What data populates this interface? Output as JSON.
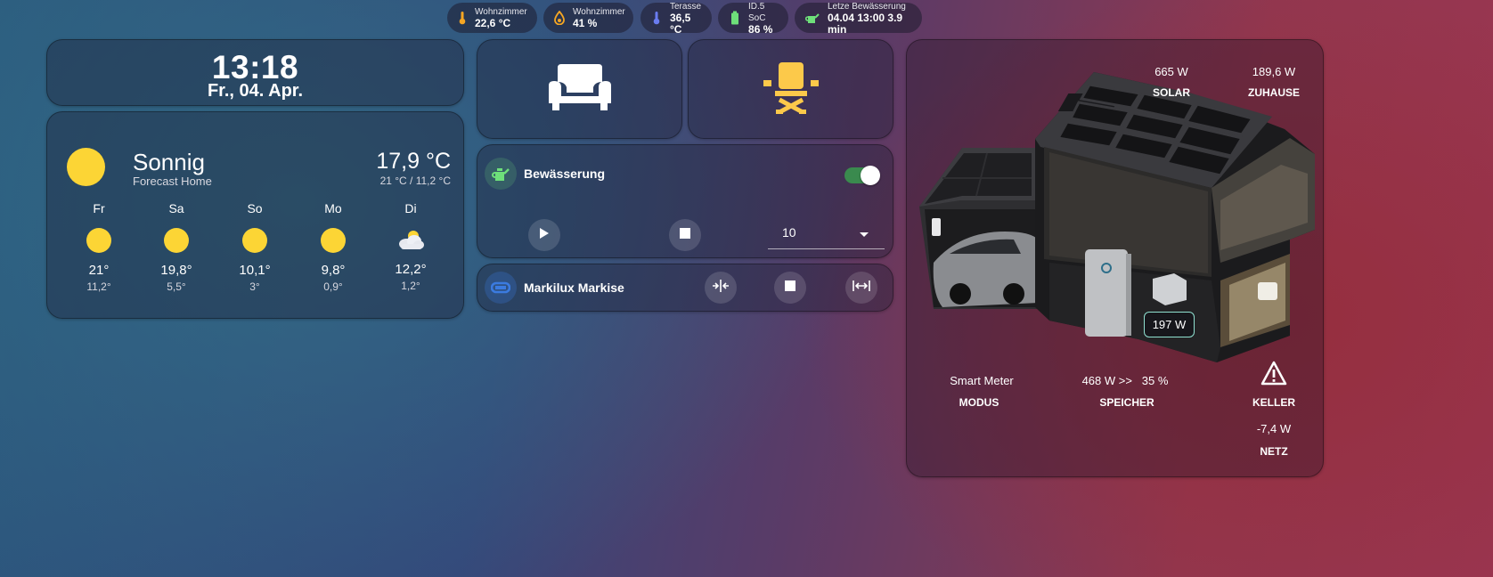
{
  "chips": [
    {
      "label": "Wohnzimmer",
      "value": "22,6 °C",
      "icon": "thermometer-icon",
      "color": "#f5a623"
    },
    {
      "label": "Wohnzimmer",
      "value": "41 %",
      "icon": "water-percent-icon",
      "color": "#f5a623"
    },
    {
      "label": "Terasse",
      "value": "36,5 °C",
      "icon": "thermometer-icon",
      "color": "#6a7cf0"
    },
    {
      "label": "ID.5 SoC",
      "value": "86 %",
      "icon": "battery-icon",
      "color": "#6ee07a"
    },
    {
      "label": "Letze Bewässerung",
      "value": "04.04 13:00 3.9 min",
      "icon": "watering-can-icon",
      "color": "#6ee07a"
    }
  ],
  "clock": {
    "time": "13:18",
    "date": "Fr., 04. Apr."
  },
  "weather": {
    "condition": "Sonnig",
    "subtitle": "Forecast Home",
    "temperature": "17,9 °C",
    "range": "21 °C / 11,2 °C",
    "forecast": [
      {
        "day": "Fr",
        "icon": "sun-icon",
        "high": "21°",
        "low": "11,2°"
      },
      {
        "day": "Sa",
        "icon": "sun-icon",
        "high": "19,8°",
        "low": "5,5°"
      },
      {
        "day": "So",
        "icon": "sun-icon",
        "high": "10,1°",
        "low": "3°"
      },
      {
        "day": "Mo",
        "icon": "sun-icon",
        "high": "9,8°",
        "low": "0,9°"
      },
      {
        "day": "Di",
        "icon": "cloud-icon",
        "high": "12,2°",
        "low": "1,2°"
      }
    ]
  },
  "tiles": {
    "sofa_icon": "sofa-icon",
    "chair_icon": "desk-chair-icon",
    "chair_color": "#fcc94a"
  },
  "irrigation": {
    "title": "Bewässerung",
    "toggle_on": true,
    "duration": "10",
    "icon_color": "#6ee07a"
  },
  "awning": {
    "title": "Markilux Markise",
    "icon_color": "#3b7be0"
  },
  "energy": {
    "solar_value": "665 W",
    "solar_label": "SOLAR",
    "home_value": "189,6 W",
    "home_label": "ZUHAUSE",
    "battery_badge": "197 W",
    "mode_value": "Smart Meter",
    "mode_label": "MODUS",
    "storage_value": "468 W >>   35 %",
    "storage_label": "SPEICHER",
    "cellar_label": "KELLER",
    "grid_value": "-7,4 W",
    "grid_label": "NETZ"
  }
}
